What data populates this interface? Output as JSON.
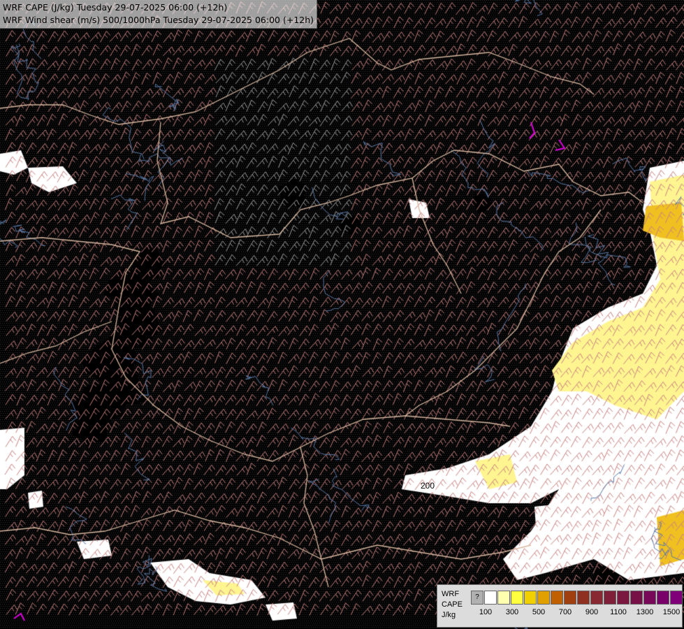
{
  "title": {
    "line1": "WRF CAPE (J/kg) Tuesday 29-07-2025 06:00 (+12h)",
    "line2": "WRF Wind shear (m/s) 500/1000hPa Tuesday 29-07-2025 06:00 (+12h)"
  },
  "legend": {
    "labels": [
      "WRF",
      "CAPE",
      "J/kg"
    ],
    "swatch_colors": [
      "#b0b0b0",
      "#ffffff",
      "#ffffb0",
      "#ffff40",
      "#f0d000",
      "#e0a000",
      "#c06000",
      "#a04010",
      "#903020",
      "#882830",
      "#802038",
      "#7a1840",
      "#781048",
      "#780858",
      "#780068",
      "#80007a"
    ],
    "first_swatch_label": "?",
    "tick_labels": [
      "100",
      "300",
      "500",
      "700",
      "900",
      "1100",
      "1300",
      "1500"
    ]
  },
  "map": {
    "contour_label": "200",
    "colors": {
      "background": "#000000",
      "border": "#d8b8a0",
      "river": "#5a7aa8",
      "barb_low": "#a0a0a0",
      "barb_high": "#c88080",
      "cape_white": "#ffffff",
      "cape_yellow": "#fff590",
      "cape_orange": "#f0c020",
      "magenta": "#e000e0"
    }
  }
}
